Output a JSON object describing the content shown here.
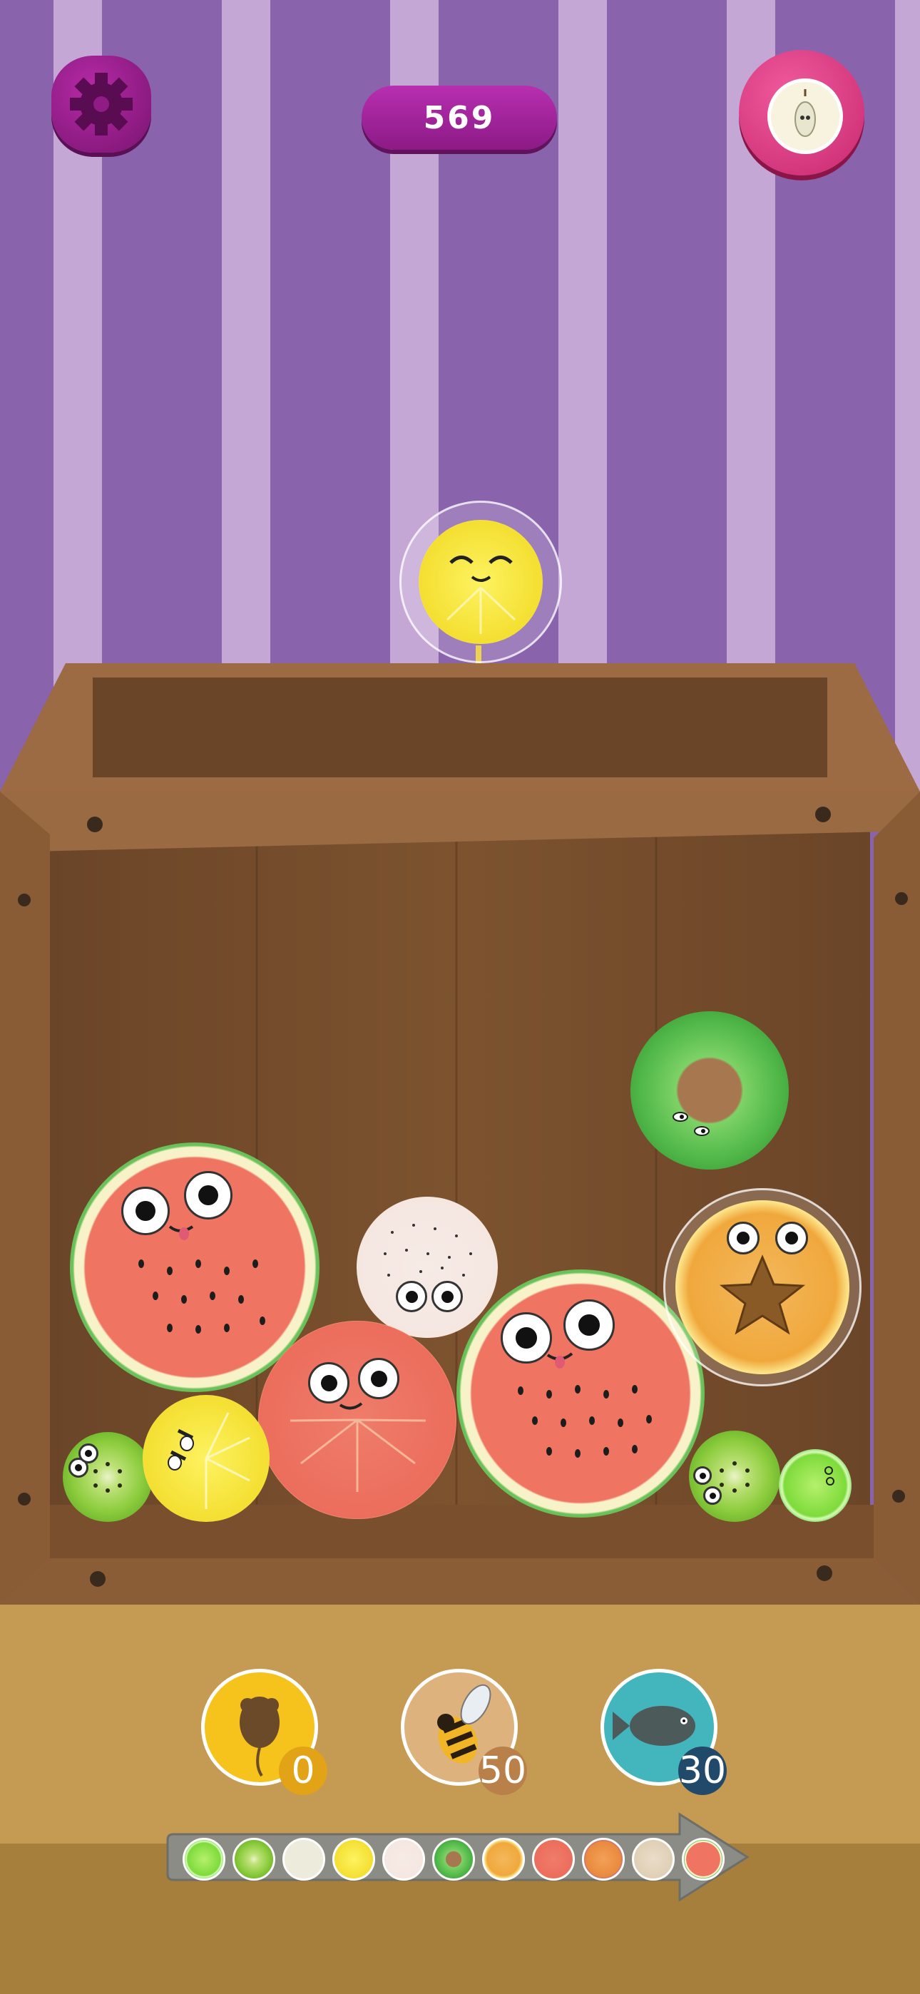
{
  "hud": {
    "score": "569",
    "settings_icon": "gear-icon",
    "next_fruit_icon": "apple-icon"
  },
  "current_fruit": "lemon",
  "box_fruits": [
    "watermelon",
    "dragonfruit",
    "grapefruit",
    "watermelon",
    "avocado",
    "orange",
    "kiwi",
    "lemon",
    "kiwi",
    "lime"
  ],
  "powerups": [
    {
      "name": "mouse",
      "icon": "mouse-icon",
      "count": "0",
      "color": "#f6c21c",
      "badge": "#e2a316"
    },
    {
      "name": "bee",
      "icon": "bee-icon",
      "count": "50",
      "color": "#ddb27d",
      "badge": "#b9804a"
    },
    {
      "name": "fish",
      "icon": "fish-icon",
      "count": "30",
      "color": "#43b5bd",
      "badge": "#214a6a"
    }
  ],
  "evolution": [
    "lime",
    "kiwi",
    "apple",
    "lemon",
    "dragonfruit",
    "avocado",
    "orange",
    "grapefruit",
    "peach",
    "coconut",
    "watermelon"
  ]
}
